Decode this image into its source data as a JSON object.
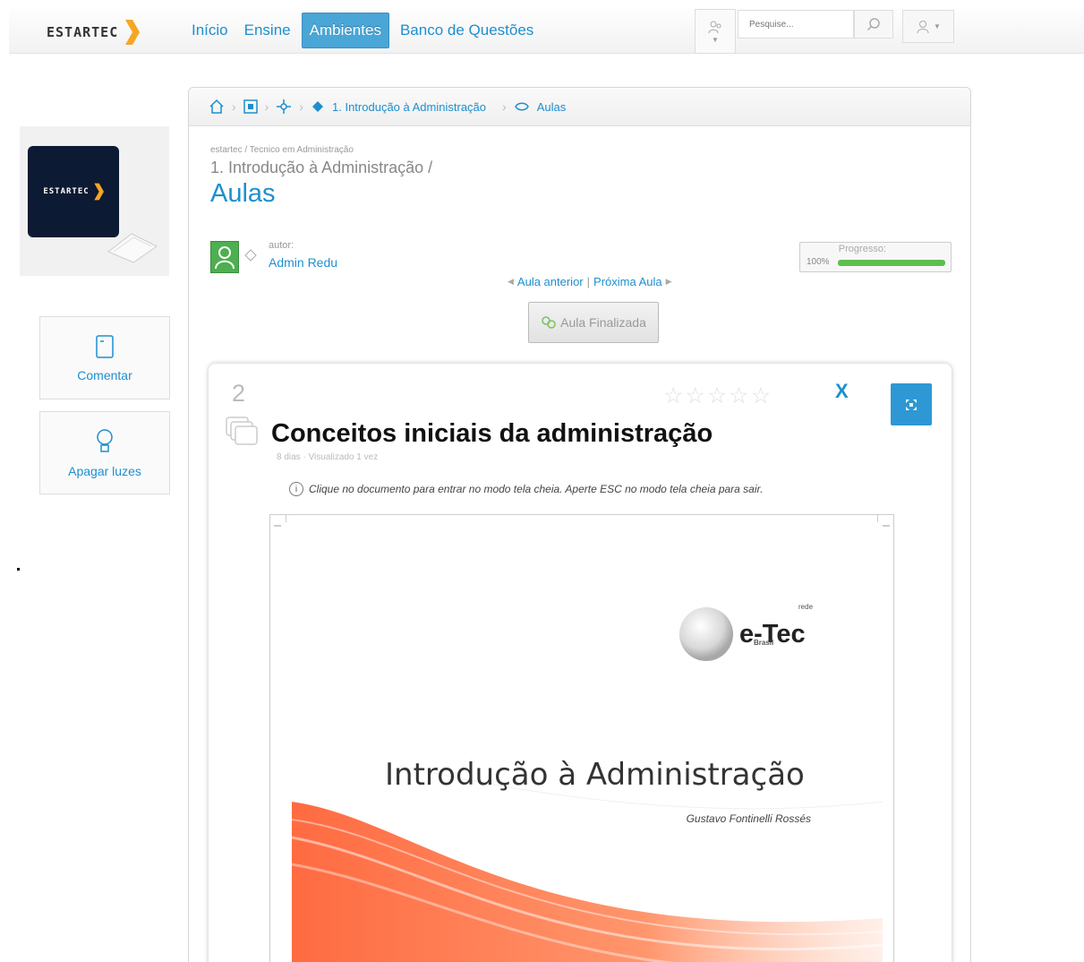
{
  "brand": {
    "name": "ESTARTEC"
  },
  "nav": {
    "items": [
      {
        "label": "Início",
        "active": false
      },
      {
        "label": "Ensine",
        "active": false
      },
      {
        "label": "Ambientes",
        "active": true
      },
      {
        "label": "Banco de Questões",
        "active": false
      }
    ]
  },
  "search": {
    "placeholder": "Pesquise..."
  },
  "sidebar": {
    "logo_text": "ESTARTEC",
    "buttons": [
      {
        "label": "Comentar",
        "icon": "comment-icon"
      },
      {
        "label": "Apagar luzes",
        "icon": "lightbulb-icon"
      }
    ]
  },
  "breadcrumb": {
    "course": "1. Introdução à Administração",
    "current": "Aulas"
  },
  "header": {
    "path": "estartec / Tecnico em Administração",
    "subtitle": "1. Introdução à Administração /",
    "title": "Aulas"
  },
  "author": {
    "label": "autor:",
    "name": "Admin Redu"
  },
  "progress": {
    "label": "Progresso:",
    "value_text": "100%",
    "value": 1.0
  },
  "aula_nav": {
    "prev": "Aula anterior",
    "next": "Próxima Aula",
    "separator": "|"
  },
  "finalizada": {
    "label": "Aula Finalizada"
  },
  "lesson": {
    "number": "2",
    "title": "Conceitos iniciais da administração",
    "meta": "8 dias · Visualizado 1 vez",
    "close": "X",
    "rating": 0,
    "fullscreen_hint": "Clique no documento para entrar no modo tela cheia. Aperte ESC no modo tela cheia para sair."
  },
  "document": {
    "logo_text": "e-Tec",
    "logo_rede": "rede",
    "logo_brasil": "Brasil",
    "title": "Introdução à Administração",
    "author": "Gustavo Fontinelli Rossés"
  },
  "colors": {
    "accent": "#1d8fcf",
    "active_nav": "#4aa6d6",
    "progress": "#5cbf4f",
    "avatar": "#4caf50",
    "brand_orange": "#f5a623"
  }
}
